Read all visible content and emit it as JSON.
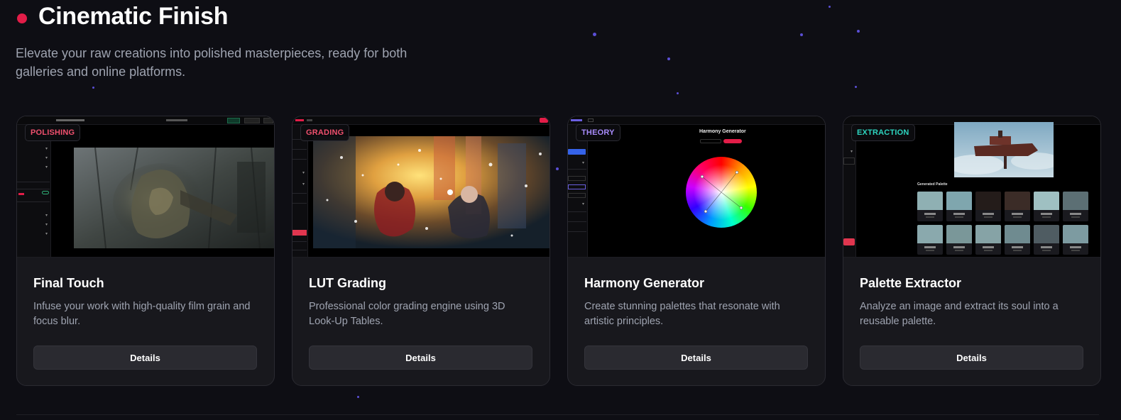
{
  "section": {
    "title": "Cinematic Finish",
    "description": "Elevate your raw creations into polished masterpieces, ready for both galleries and online platforms.",
    "accent": "#e21d48"
  },
  "cards": [
    {
      "tag": "POLISHING",
      "tag_color": "#f0506e",
      "title": "Final Touch",
      "description": "Infuse your work with high-quality film grain and focus blur.",
      "button": "Details"
    },
    {
      "tag": "GRADING",
      "tag_color": "#f0506e",
      "title": "LUT Grading",
      "description": "Professional color grading engine using 3D Look-Up Tables.",
      "button": "Details"
    },
    {
      "tag": "THEORY",
      "tag_color": "#a78bfa",
      "title": "Harmony Generator",
      "description": "Create stunning palettes that resonate with artistic principles.",
      "button": "Details",
      "preview_heading": "Harmony Generator"
    },
    {
      "tag": "EXTRACTION",
      "tag_color": "#2dd4bf",
      "title": "Palette Extractor",
      "description": "Analyze an image and extract its soul into a reusable palette.",
      "button": "Details",
      "preview_heading": "Generated Palette",
      "swatches": [
        "#8fb0b3",
        "#7fa6ae",
        "#241c1a",
        "#3b2c27",
        "#9fc0c2",
        "#5c6f74",
        "#8aa9ad",
        "#7a9799",
        "#86a3a6",
        "#6f8b90",
        "#4f5c62",
        "#7d9ba1"
      ]
    }
  ]
}
